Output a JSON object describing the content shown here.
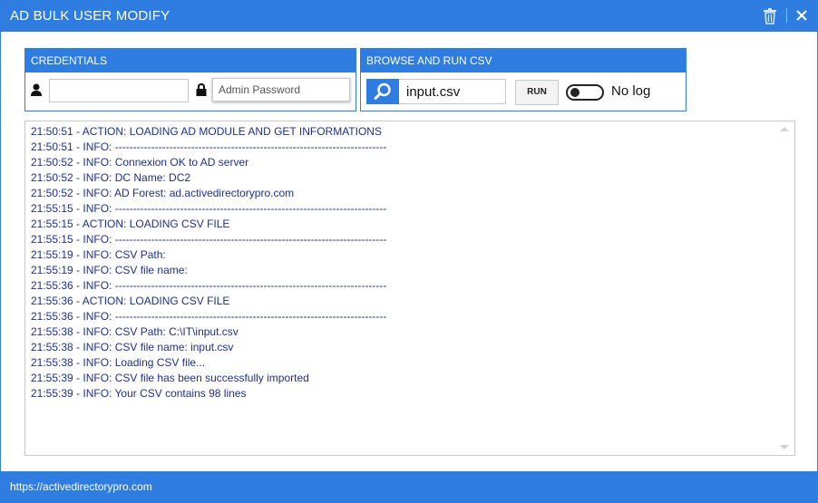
{
  "window": {
    "title": "AD BULK USER MODIFY",
    "accent_color": "#2f7de1",
    "icons": [
      "trash-icon",
      "close-icon"
    ]
  },
  "credentials": {
    "header": "CREDENTIALS",
    "username_value": "",
    "password_placeholder": "Admin Password",
    "icons": [
      "user-icon",
      "lock-icon"
    ]
  },
  "browse": {
    "header": "BROWSE AND RUN CSV",
    "file_value": "input.csv",
    "run_label": "RUN",
    "toggle_label": "No log",
    "toggle_on": false,
    "icons": [
      "search-icon"
    ]
  },
  "log": {
    "text_color": "#1e2f8f",
    "lines": [
      "21:50:51 - ACTION: LOADING AD MODULE AND GET INFORMATIONS",
      "21:50:51 - INFO: ---------------------------------------------------------------------------",
      "21:50:52 - INFO: Connexion OK to AD server",
      "21:50:52 - INFO: DC Name: DC2",
      "21:50:52 - INFO: AD Forest: ad.activedirectorypro.com",
      "21:55:15 - INFO: ---------------------------------------------------------------------------",
      "21:55:15 - ACTION: LOADING CSV FILE",
      "21:55:15 - INFO: ---------------------------------------------------------------------------",
      "21:55:19 - INFO: CSV Path:",
      "21:55:19 - INFO: CSV file name:",
      "21:55:36 - INFO: ---------------------------------------------------------------------------",
      "21:55:36 - ACTION: LOADING CSV FILE",
      "21:55:36 - INFO: ---------------------------------------------------------------------------",
      "21:55:38 - INFO: CSV Path: C:\\IT\\input.csv",
      "21:55:38 - INFO: CSV file name: input.csv",
      "21:55:38 - INFO: Loading CSV file...",
      "21:55:39 - INFO: CSV file has been successfully imported",
      "21:55:39 - INFO: Your CSV contains 98 lines"
    ]
  },
  "footer": {
    "link_text": "https://activedirectorypro.com"
  }
}
